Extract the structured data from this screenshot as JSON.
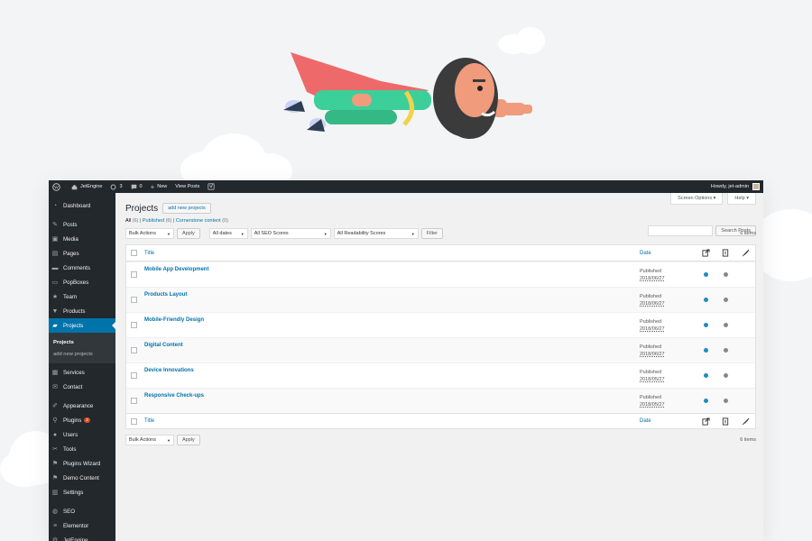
{
  "admin_bar": {
    "site_name": "JetEngine",
    "updates": "3",
    "comments": "0",
    "new_label": "New",
    "view_posts": "View Posts",
    "howdy": "Howdy, jet-admin"
  },
  "sidebar": {
    "items_top": [
      {
        "label": "Dashboard",
        "icon": "gauge-icon"
      }
    ],
    "items_main": [
      {
        "label": "Posts",
        "icon": "pin-icon"
      },
      {
        "label": "Media",
        "icon": "media-icon"
      },
      {
        "label": "Pages",
        "icon": "page-icon"
      },
      {
        "label": "Comments",
        "icon": "comment-icon"
      },
      {
        "label": "PopBoxes",
        "icon": "popbox-icon"
      },
      {
        "label": "Team",
        "icon": "star-icon"
      },
      {
        "label": "Products",
        "icon": "cart-icon"
      },
      {
        "label": "Projects",
        "icon": "folder-icon"
      }
    ],
    "submenu": [
      "Projects",
      "add new projects"
    ],
    "items_after": [
      {
        "label": "Services",
        "icon": "services-icon"
      },
      {
        "label": "Contact",
        "icon": "mail-icon"
      }
    ],
    "items_admin": [
      {
        "label": "Appearance",
        "icon": "brush-icon"
      },
      {
        "label": "Plugins",
        "icon": "plugin-icon",
        "badge": "2"
      },
      {
        "label": "Users",
        "icon": "user-icon"
      },
      {
        "label": "Tools",
        "icon": "wrench-icon"
      },
      {
        "label": "Plugins Wizard",
        "icon": "flag-icon"
      },
      {
        "label": "Demo Content",
        "icon": "flag-icon"
      },
      {
        "label": "Settings",
        "icon": "settings-icon"
      }
    ],
    "items_extra": [
      {
        "label": "SEO",
        "icon": "seo-icon"
      },
      {
        "label": "Elementor",
        "icon": "elementor-icon"
      },
      {
        "label": "JetEngine",
        "icon": "engine-icon"
      }
    ]
  },
  "header": {
    "screen_options": "Screen Options",
    "help": "Help",
    "title": "Projects",
    "add_new": "add new projects"
  },
  "views": {
    "all": "All",
    "all_count": "(6)",
    "published": "Published",
    "published_count": "(6)",
    "cornerstone": "Cornerstone content",
    "cornerstone_count": "(0)"
  },
  "search_button": "Search Posts",
  "filters": {
    "bulk": "Bulk Actions",
    "apply": "Apply",
    "dates": "All dates",
    "seo": "All SEO Scores",
    "readability": "All Readability Scores",
    "filter": "Filter"
  },
  "items_count": "6 items",
  "table": {
    "col_title": "Title",
    "col_date": "Date",
    "rows": [
      {
        "title": "Mobile App Development",
        "status": "Published",
        "date": "2018/06/27"
      },
      {
        "title": "Products Layout",
        "status": "Published",
        "date": "2018/06/27"
      },
      {
        "title": "Mobile-Friendly Design",
        "status": "Published",
        "date": "2018/06/27"
      },
      {
        "title": "Digital Content",
        "status": "Published",
        "date": "2018/06/27"
      },
      {
        "title": "Device Innovations",
        "status": "Published",
        "date": "2018/05/27"
      },
      {
        "title": "Responsive Check-ups",
        "status": "Published",
        "date": "2018/05/27"
      }
    ]
  },
  "colors": {
    "seo_dot": "#1e8cbe",
    "readability_dot": "#888888",
    "accent": "#0073aa",
    "sidebar": "#23282d"
  }
}
